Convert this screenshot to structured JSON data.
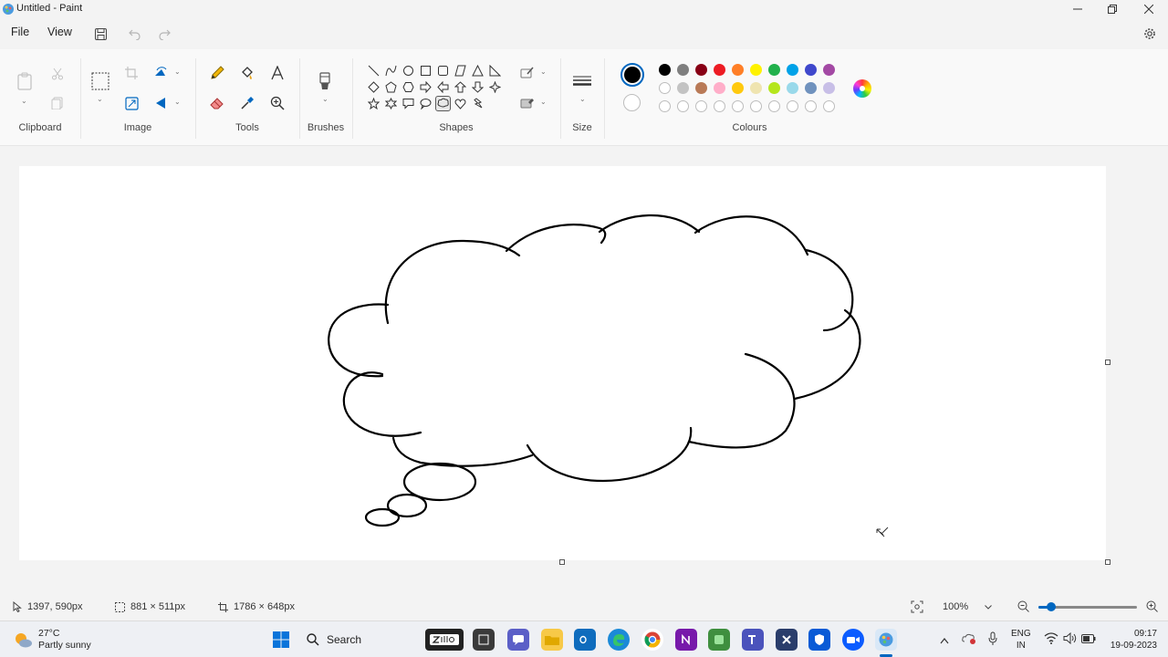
{
  "window": {
    "title": "Untitled - Paint",
    "controls": [
      "minimize",
      "maximize",
      "close"
    ]
  },
  "menu": {
    "file": "File",
    "view": "View"
  },
  "ribbon": {
    "groups": {
      "clipboard": "Clipboard",
      "image": "Image",
      "tools": "Tools",
      "brushes": "Brushes",
      "shapes": "Shapes",
      "size": "Size",
      "colours": "Colours"
    },
    "shapes_selected": "cloud-callout",
    "primary_colour": "#000000",
    "secondary_colour": "#ffffff",
    "palette_row1": [
      "#000000",
      "#7f7f7f",
      "#880015",
      "#ed1c24",
      "#ff7f27",
      "#fff200",
      "#22b14c",
      "#00a2e8",
      "#3f48cc",
      "#a349a4"
    ],
    "palette_row2": [
      "#ffffff",
      "#c3c3c3",
      "#b97a57",
      "#ffaec9",
      "#ffc90e",
      "#efe4b0",
      "#b5e61d",
      "#99d9ea",
      "#7092be",
      "#c8bfe7"
    ],
    "palette_row3_custom_slots": 10
  },
  "status": {
    "cursor_pos": "1397, 590px",
    "selection_size": "881 × 511px",
    "canvas_size": "1786 × 648px",
    "zoom": "100%",
    "zoom_slider_fraction": 0.13
  },
  "taskbar": {
    "weather_temp": "27°C",
    "weather_desc": "Partly sunny",
    "search_label": "Search",
    "lang_top": "ENG",
    "lang_bottom": "IN",
    "time": "09:17",
    "date": "19-09-2023"
  }
}
